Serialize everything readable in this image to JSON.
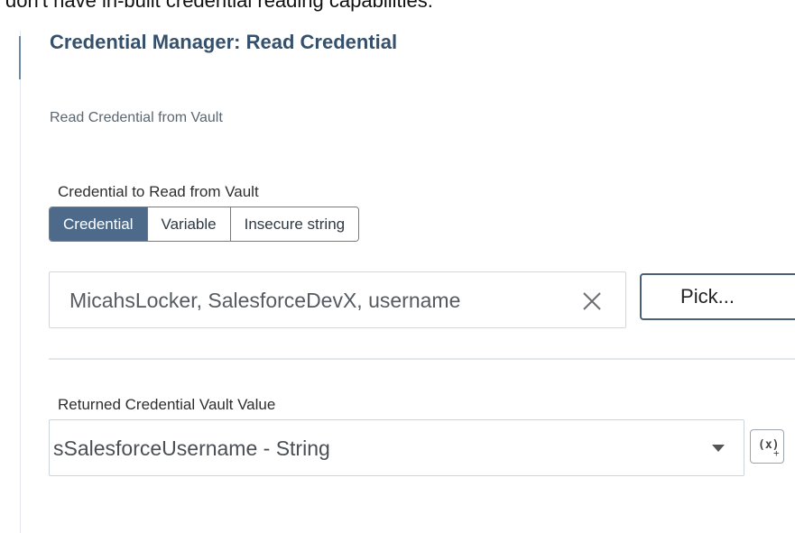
{
  "header_snippet": "don't have in-built credential reading capabilities.",
  "panel": {
    "title": "Credential Manager: Read Credential",
    "description": "Read Credential from Vault"
  },
  "credential_source": {
    "label": "Credential to Read from Vault",
    "options": [
      "Credential",
      "Variable",
      "Insecure string"
    ],
    "selected": "Credential"
  },
  "credential_field": {
    "value": "MicahsLocker, SalesforceDevX, username",
    "clear_icon": "close-icon",
    "pick_label": "Pick..."
  },
  "returned_value": {
    "label": "Returned Credential Vault Value",
    "value": "sSalesforceUsername - String",
    "dropdown_icon": "chevron-down-icon",
    "variable_button_label": "(x)",
    "variable_button_plus": "+"
  },
  "colors": {
    "title": "#35506b",
    "segmented_active_bg": "#4e6a8a",
    "button_border": "#4a6077"
  }
}
